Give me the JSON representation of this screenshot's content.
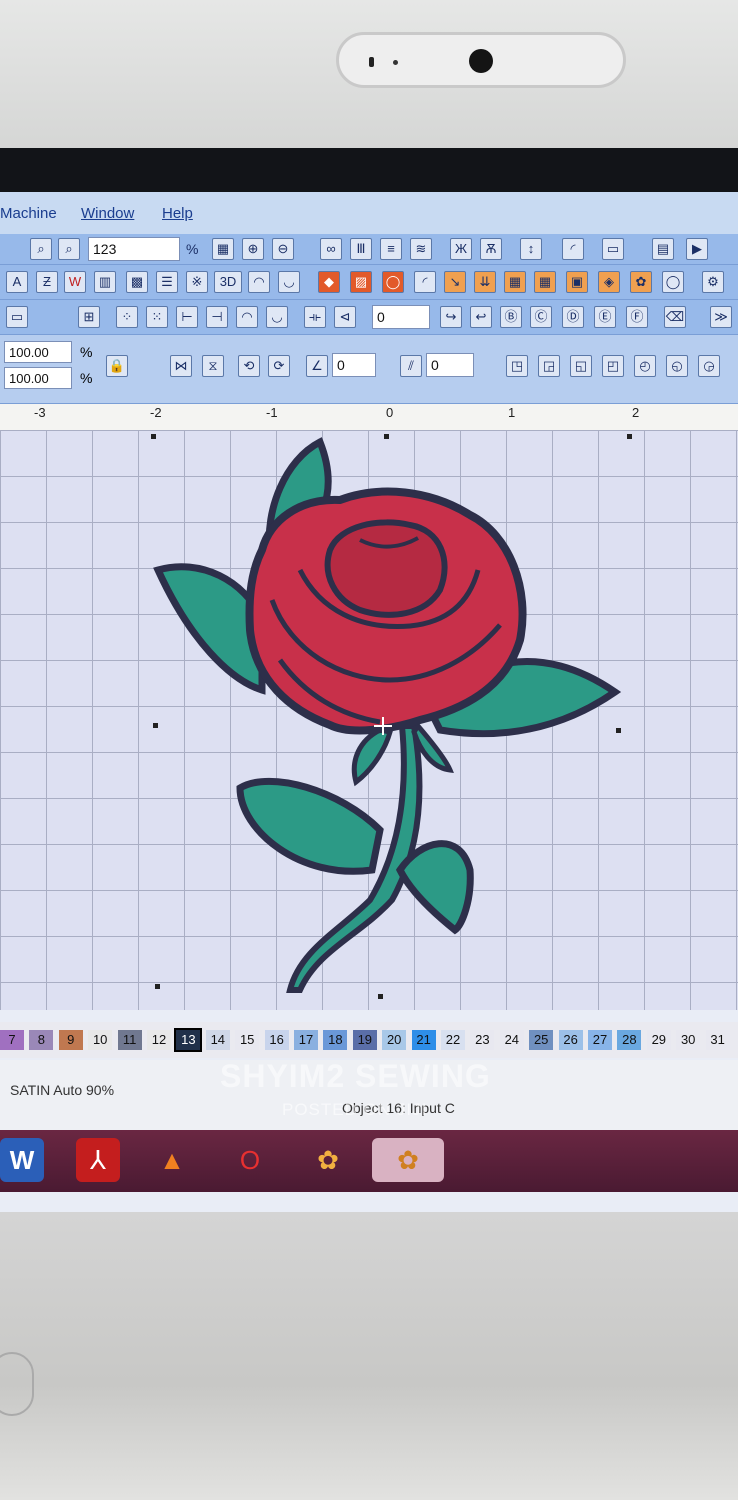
{
  "menubar": {
    "machine": "Machine",
    "window": "Window",
    "help": "Help"
  },
  "toolbar1": {
    "zoom_value": "123",
    "percent": "%"
  },
  "toolbar3": {
    "stitch_value": "0"
  },
  "toolbar4": {
    "scale_width": "100.00",
    "scale_height": "100.00",
    "percent": "%",
    "angle_value": "0",
    "slant_value": "0"
  },
  "ruler": {
    "labels": [
      "-3",
      "-2",
      "-1",
      "0",
      "1",
      "2"
    ]
  },
  "palette": {
    "swatches": [
      {
        "label": "7",
        "color": "#a070c0"
      },
      {
        "label": "8",
        "color": "#9a88b8"
      },
      {
        "label": "9",
        "color": "#c07850"
      },
      {
        "label": "10",
        "color": "#e8e8e8"
      },
      {
        "label": "11",
        "color": "#707890"
      },
      {
        "label": "12",
        "color": "#e8e8e8"
      },
      {
        "label": "13",
        "color": "#20304a"
      },
      {
        "label": "14",
        "color": "#d0d8e8"
      },
      {
        "label": "15",
        "color": "#e8e8f0"
      },
      {
        "label": "16",
        "color": "#c8d4ec"
      },
      {
        "label": "17",
        "color": "#8ab0e0"
      },
      {
        "label": "18",
        "color": "#6a98d8"
      },
      {
        "label": "19",
        "color": "#5a6ea8"
      },
      {
        "label": "20",
        "color": "#a8c8e8"
      },
      {
        "label": "21",
        "color": "#2e8ee8"
      },
      {
        "label": "22",
        "color": "#d8e0f0"
      },
      {
        "label": "23",
        "color": "#e8e8f0"
      },
      {
        "label": "24",
        "color": "#e8e8f0"
      },
      {
        "label": "25",
        "color": "#7090c0"
      },
      {
        "label": "26",
        "color": "#9cc0e8"
      },
      {
        "label": "27",
        "color": "#88b4e8"
      },
      {
        "label": "28",
        "color": "#6aa8e0"
      },
      {
        "label": "29",
        "color": "#e8e8f0"
      },
      {
        "label": "30",
        "color": "#e8e8f0"
      },
      {
        "label": "31",
        "color": "#e8e8f0"
      }
    ]
  },
  "status": {
    "stitch_type": "SATIN Auto 90%",
    "object_info": "Object 16: Input C"
  },
  "watermark": {
    "line1": "SHYIM2 SEWING",
    "line2": "POSTED ON JIJI"
  },
  "design": {
    "colors": {
      "petal": "#c8304a",
      "petal_dark": "#9a1f36",
      "leaf": "#2c9a86",
      "leaf_dark": "#1f6f60",
      "outline": "#2d2f4a"
    }
  }
}
